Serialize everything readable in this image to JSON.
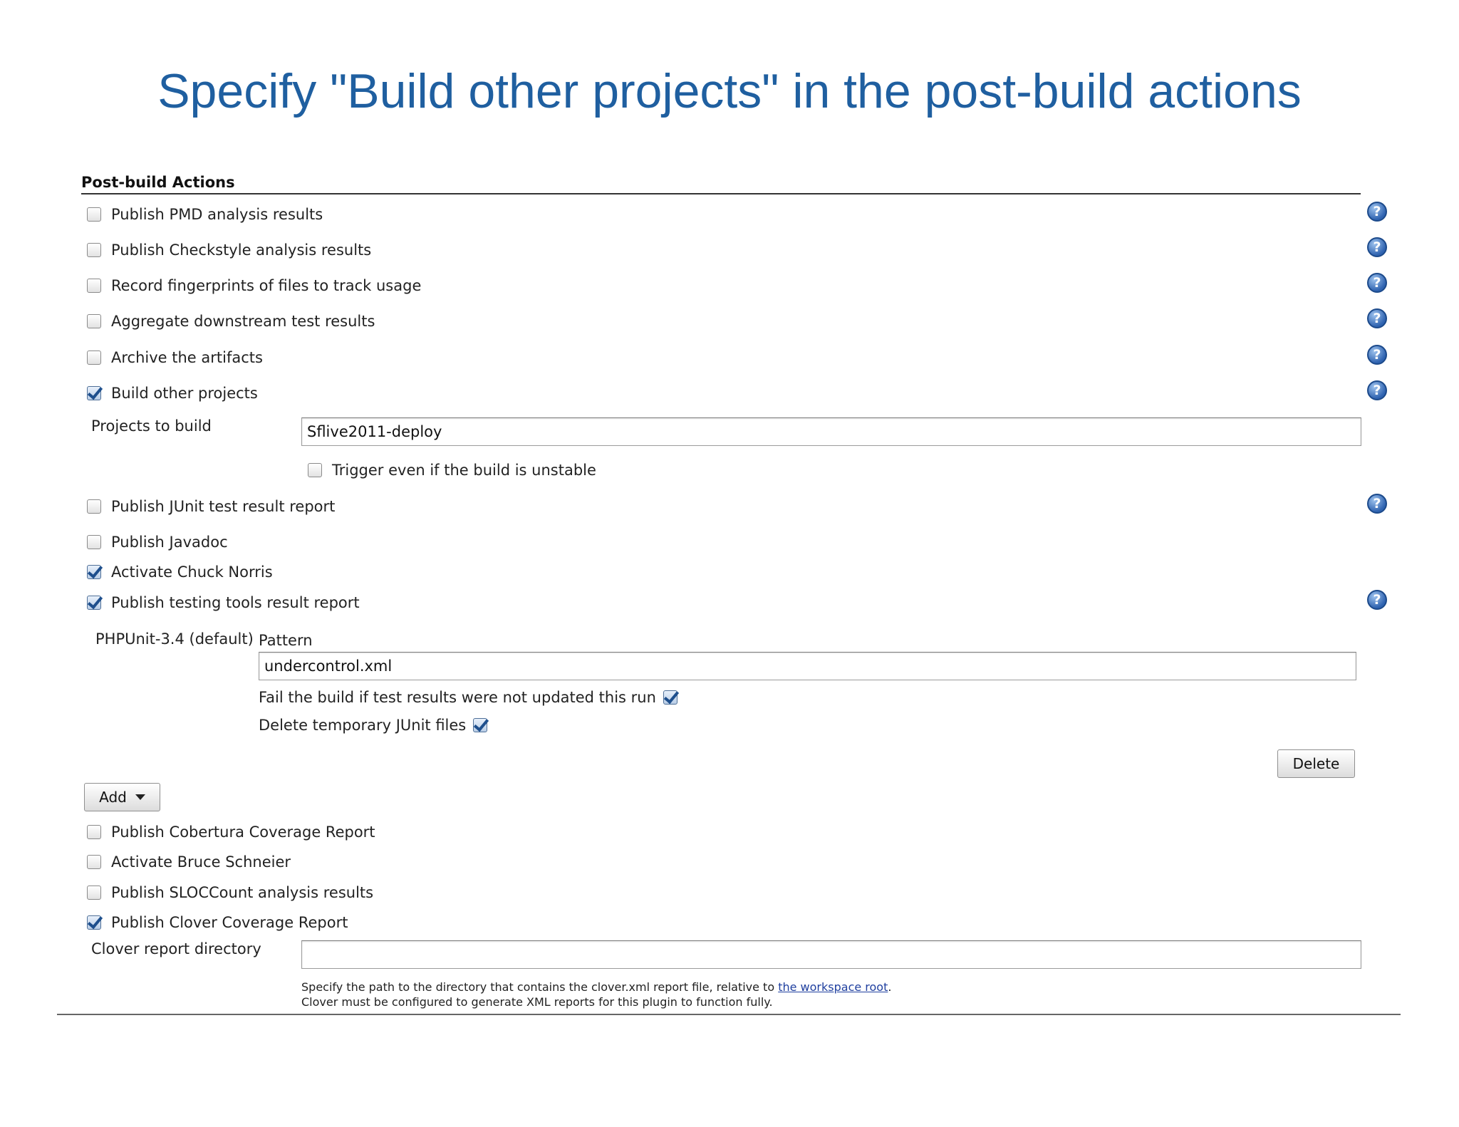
{
  "slide_title": "Specify \"Build other projects\" in the post-build actions",
  "section": {
    "title": "Post-build Actions"
  },
  "actions": [
    {
      "label": "Publish PMD analysis results",
      "checked": false
    },
    {
      "label": "Publish Checkstyle analysis results",
      "checked": false
    },
    {
      "label": "Record fingerprints of files to track usage",
      "checked": false
    },
    {
      "label": "Aggregate downstream test results",
      "checked": false
    },
    {
      "label": "Archive the artifacts",
      "checked": false
    },
    {
      "label": "Build other projects",
      "checked": true
    },
    {
      "label": "Publish JUnit test result report",
      "checked": false
    },
    {
      "label": "Publish Javadoc",
      "checked": false
    },
    {
      "label": "Activate Chuck Norris",
      "checked": true
    },
    {
      "label": "Publish testing tools result report",
      "checked": true
    },
    {
      "label": "Publish Cobertura Coverage Report",
      "checked": false
    },
    {
      "label": "Activate Bruce Schneier",
      "checked": false
    },
    {
      "label": "Publish SLOCCount analysis results",
      "checked": false
    },
    {
      "label": "Publish Clover Coverage Report",
      "checked": true
    }
  ],
  "build_other": {
    "projects_label": "Projects to build",
    "projects_value": "Sflive2011-deploy",
    "trigger_unstable_label": "Trigger even if the build is unstable",
    "trigger_unstable_checked": false
  },
  "testing_tools": {
    "tool_label": "PHPUnit-3.4 (default)",
    "pattern_label": "Pattern",
    "pattern_value": "undercontrol.xml",
    "fail_label": "Fail the build if test results were not updated this run",
    "fail_checked": true,
    "delete_temp_label": "Delete temporary JUnit files",
    "delete_temp_checked": true,
    "delete_button": "Delete",
    "add_button": "Add"
  },
  "clover": {
    "dir_label": "Clover report directory",
    "dir_value": "",
    "hint_line1_before": "Specify the path to the directory that contains the clover.xml report file, relative to ",
    "hint_link": "the workspace root",
    "hint_line1_after": ".",
    "hint_line2": "Clover must be configured to generate XML reports for this plugin to function fully."
  },
  "icons": {
    "help": "help-icon",
    "help_glyph": "?",
    "dropdown": "chevron-down-icon"
  },
  "colors": {
    "title": "#1f5fa0",
    "link": "#1f3f9f",
    "check": "#1e4f8d"
  }
}
